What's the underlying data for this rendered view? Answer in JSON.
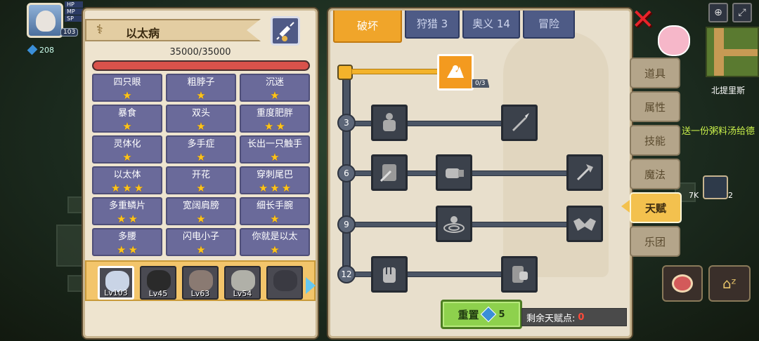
{
  "player": {
    "stat_labels": [
      "HP",
      "MP",
      "SP"
    ],
    "level": "103",
    "gems": "208"
  },
  "trait_panel": {
    "title": "以太病",
    "hp_text": "35000/35000",
    "hp_fraction": 1.0,
    "traits": [
      {
        "name": "四只眼",
        "stars": 1
      },
      {
        "name": "粗脖子",
        "stars": 1
      },
      {
        "name": "沉迷",
        "stars": 1
      },
      {
        "name": "暴食",
        "stars": 1
      },
      {
        "name": "双头",
        "stars": 1
      },
      {
        "name": "重度肥胖",
        "stars": 2
      },
      {
        "name": "灵体化",
        "stars": 1
      },
      {
        "name": "多手症",
        "stars": 1
      },
      {
        "name": "长出一只触手",
        "stars": 1
      },
      {
        "name": "以太体",
        "stars": 3
      },
      {
        "name": "开花",
        "stars": 1
      },
      {
        "name": "穿刺尾巴",
        "stars": 3
      },
      {
        "name": "多重鳞片",
        "stars": 2
      },
      {
        "name": "宽阔肩膀",
        "stars": 1
      },
      {
        "name": "细长手腕",
        "stars": 1
      },
      {
        "name": "多腰",
        "stars": 2
      },
      {
        "name": "闪电小子",
        "stars": 1
      },
      {
        "name": "你就是以太",
        "stars": 1
      }
    ],
    "characters": [
      {
        "level": "Lv103",
        "selected": true,
        "color": "#c9d4e6"
      },
      {
        "level": "Lv45",
        "selected": false,
        "color": "#2a2a2a"
      },
      {
        "level": "Lv63",
        "selected": false,
        "color": "#8a7a72"
      },
      {
        "level": "Lv54",
        "selected": false,
        "color": "#b0b0a8"
      },
      {
        "level": "",
        "selected": false,
        "color": "#3a3a42"
      }
    ]
  },
  "talent_panel": {
    "tabs": [
      {
        "label": "破坏",
        "active": true
      },
      {
        "label": "狩猎 3",
        "active": false
      },
      {
        "label": "奥义 14",
        "active": false
      },
      {
        "label": "冒险",
        "active": false
      }
    ],
    "top_skill_count": "0/3",
    "tiers": [
      "3",
      "6",
      "9",
      "12"
    ],
    "reset_label": "重置",
    "reset_cost": "5",
    "points_label": "剩余天赋点:",
    "points_value": "0"
  },
  "side_menu": [
    {
      "label": "道具",
      "active": false
    },
    {
      "label": "属性",
      "active": false
    },
    {
      "label": "技能",
      "active": false
    },
    {
      "label": "魔法",
      "active": false
    },
    {
      "label": "天赋",
      "active": true
    },
    {
      "label": "乐团",
      "active": false
    }
  ],
  "world": {
    "location": "北提里斯",
    "message": "送一份粥料汤给德",
    "count_a": "7K",
    "count_b": "2"
  },
  "colors": {
    "accent_gold": "#f3c14e",
    "tab_active": "#f0a52a",
    "hp_red": "#d9524b",
    "reset_green": "#8ed14d",
    "star": "#ffc51a"
  }
}
